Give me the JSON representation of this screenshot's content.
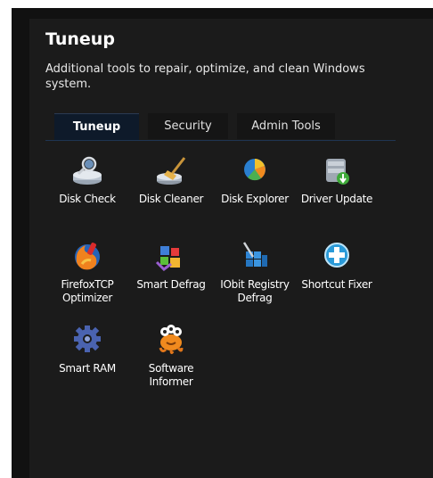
{
  "header": {
    "title": "Tuneup",
    "description": "Additional tools to repair, optimize, and clean Windows system."
  },
  "tabs": [
    {
      "label": "Tuneup",
      "active": true
    },
    {
      "label": "Security",
      "active": false
    },
    {
      "label": "Admin Tools",
      "active": false
    }
  ],
  "tools": [
    {
      "label": "Disk Check",
      "icon": "disk-check-icon"
    },
    {
      "label": "Disk Cleaner",
      "icon": "disk-cleaner-icon"
    },
    {
      "label": "Disk Explorer",
      "icon": "disk-explorer-icon"
    },
    {
      "label": "Driver Update",
      "icon": "driver-update-icon"
    },
    {
      "label": "FirefoxTCP Optimizer",
      "icon": "firefox-tcp-icon"
    },
    {
      "label": "Smart Defrag",
      "icon": "smart-defrag-icon"
    },
    {
      "label": "IObit Registry Defrag",
      "icon": "registry-defrag-icon"
    },
    {
      "label": "Shortcut Fixer",
      "icon": "shortcut-fixer-icon"
    },
    {
      "label": "Smart RAM",
      "icon": "smart-ram-icon"
    },
    {
      "label": "Software Informer",
      "icon": "software-informer-icon"
    }
  ],
  "colors": {
    "panel_bg": "#1b1b1b",
    "active_tab": "#0e1a2a",
    "text": "#ffffff"
  }
}
